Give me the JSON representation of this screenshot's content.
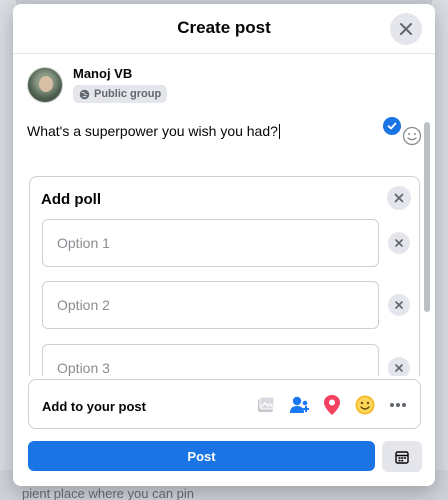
{
  "background": {
    "partial_text": "pient place where you can pin"
  },
  "dialog": {
    "title": "Create post",
    "close_icon": "close-icon"
  },
  "author": {
    "name": "Manoj VB",
    "privacy_label": "Public group",
    "privacy_icon": "globe-icon"
  },
  "composer": {
    "text": "What's a superpower you wish you had?"
  },
  "poll": {
    "title": "Add poll",
    "options": [
      {
        "placeholder": "Option 1"
      },
      {
        "placeholder": "Option 2"
      },
      {
        "placeholder": "Option 3"
      }
    ]
  },
  "add_to_post": {
    "label": "Add to your post",
    "tools": [
      "photo-icon",
      "tag-people-icon",
      "location-pin-icon",
      "feeling-emoji-icon",
      "more-options-icon"
    ]
  },
  "actions": {
    "post_label": "Post",
    "schedule_icon": "calendar-icon"
  },
  "colors": {
    "accent": "#1b74e4",
    "tag_blue": "#1877f2",
    "location_red": "#f3425f",
    "emoji_yellow": "#f7b928"
  }
}
